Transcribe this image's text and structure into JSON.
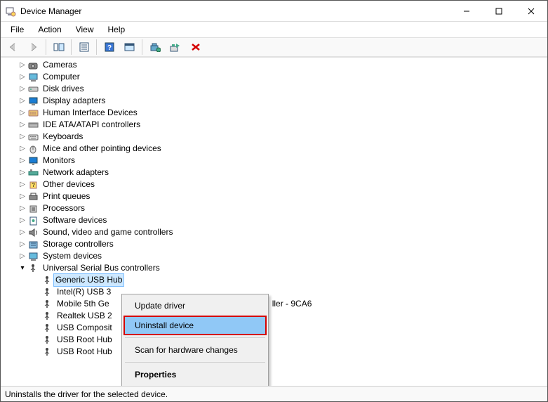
{
  "title": "Device Manager",
  "menu": {
    "file": "File",
    "action": "Action",
    "view": "View",
    "help": "Help"
  },
  "tree": {
    "cameras": "Cameras",
    "computer": "Computer",
    "disk": "Disk drives",
    "display": "Display adapters",
    "hid": "Human Interface Devices",
    "ide": "IDE ATA/ATAPI controllers",
    "keyboards": "Keyboards",
    "mice": "Mice and other pointing devices",
    "monitors": "Monitors",
    "network": "Network adapters",
    "other": "Other devices",
    "print": "Print queues",
    "processors": "Processors",
    "software": "Software devices",
    "sound": "Sound, video and game controllers",
    "storage": "Storage controllers",
    "system": "System devices",
    "usb": "Universal Serial Bus controllers",
    "usb_children": {
      "generic": "Generic USB Hub",
      "intel3": "Intel(R) USB 3",
      "mobile": "Mobile 5th Ge",
      "realtek": "Realtek USB 2",
      "composite": "USB Composit",
      "root1": "USB Root Hub",
      "root2": "USB Root Hub",
      "partial_suffix": "ller - 9CA6"
    }
  },
  "context_menu": {
    "update": "Update driver",
    "uninstall": "Uninstall device",
    "scan": "Scan for hardware changes",
    "properties": "Properties"
  },
  "status": "Uninstalls the driver for the selected device."
}
